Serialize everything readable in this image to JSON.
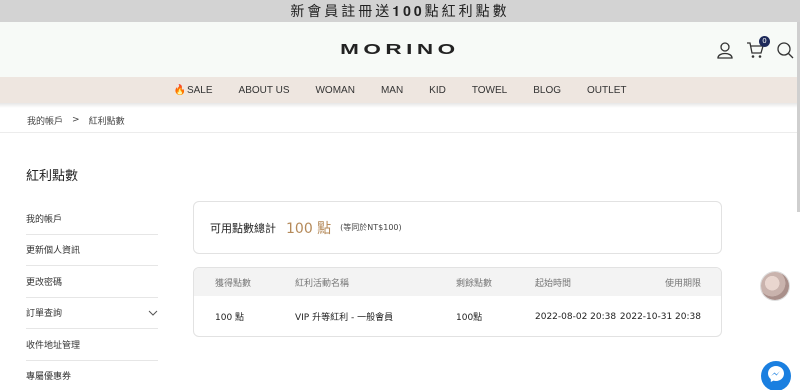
{
  "promo_banner": "新會員註冊送𝟏𝟎𝟎點紅利點數",
  "header": {
    "logo": "MORINO",
    "cart_count": "0"
  },
  "nav": {
    "items": [
      {
        "label": "SALE",
        "icon": "fire-icon"
      },
      {
        "label": "ABOUT US"
      },
      {
        "label": "WOMAN"
      },
      {
        "label": "MAN"
      },
      {
        "label": "KID"
      },
      {
        "label": "TOWEL"
      },
      {
        "label": "BLOG"
      },
      {
        "label": "OUTLET"
      }
    ]
  },
  "breadcrumb": {
    "parent": "我的帳戶",
    "separator": ">",
    "current": "紅利點數"
  },
  "page_title": "紅利點數",
  "sidebar": {
    "items": [
      {
        "label": "我的帳戶"
      },
      {
        "label": "更新個人資訊"
      },
      {
        "label": "更改密碼"
      },
      {
        "label": "訂單查詢",
        "has_submenu": true
      },
      {
        "label": "收件地址管理"
      },
      {
        "label": "專屬優惠券"
      }
    ]
  },
  "points_summary": {
    "label": "可用點數總計",
    "value": "100 點",
    "note": "(等同於NT$100)"
  },
  "table": {
    "headers": [
      "獲得點數",
      "紅利活動名稱",
      "剩餘點數",
      "起始時間",
      "使用期限"
    ],
    "rows": [
      [
        "100 點",
        "VIP 升等紅利 - 一般會員",
        "100點",
        "2022-08-02 20:38",
        "2022-10-31 20:38"
      ]
    ]
  },
  "colors": {
    "accent_points": "#b58a5a",
    "nav_bg": "#eee6e0",
    "chat_button": "#1a7fe0",
    "cart_badge": "#1e2a5a"
  }
}
